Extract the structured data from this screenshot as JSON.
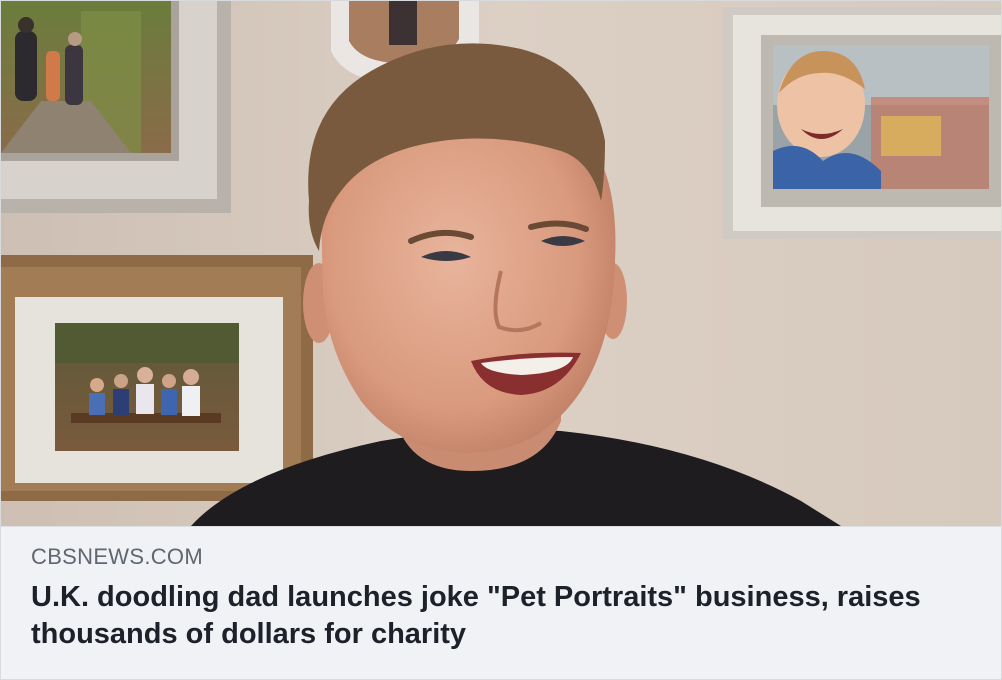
{
  "link_preview": {
    "domain": "CBSNEWS.COM",
    "headline": "U.K. doodling dad launches joke \"Pet Portraits\" business, raises thousands of dollars for charity"
  },
  "colors": {
    "card_background": "#f0f2f5",
    "domain_text": "#606770",
    "headline_text": "#1d2129",
    "wall": "#d9ccc0"
  }
}
